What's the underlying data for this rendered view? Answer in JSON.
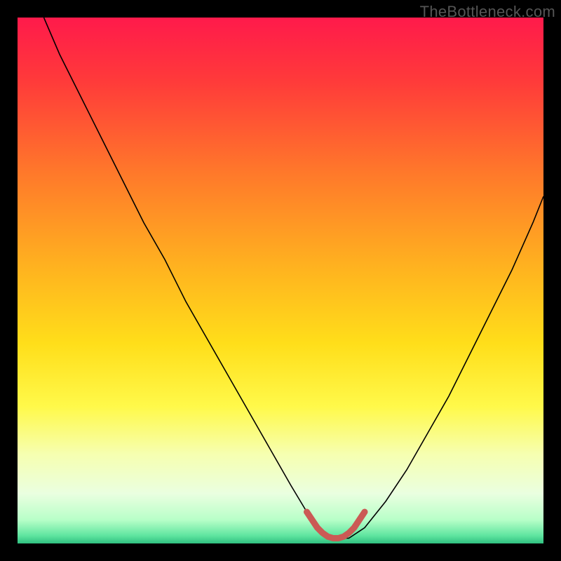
{
  "watermark": "TheBottleneck.com",
  "colors": {
    "frame_bg": "#000000",
    "curve_stroke": "#000000",
    "sweet_stroke": "#cb5a55"
  },
  "chart_data": {
    "type": "line",
    "title": "",
    "xlabel": "",
    "ylabel": "",
    "xlim": [
      0,
      100
    ],
    "ylim": [
      0,
      100
    ],
    "gradient_stops": [
      {
        "offset": 0.0,
        "color": "#ff1a4b"
      },
      {
        "offset": 0.12,
        "color": "#ff3a3a"
      },
      {
        "offset": 0.3,
        "color": "#ff7a2a"
      },
      {
        "offset": 0.48,
        "color": "#ffb41f"
      },
      {
        "offset": 0.62,
        "color": "#ffde1a"
      },
      {
        "offset": 0.74,
        "color": "#fff94a"
      },
      {
        "offset": 0.83,
        "color": "#f6ffb0"
      },
      {
        "offset": 0.905,
        "color": "#eaffe0"
      },
      {
        "offset": 0.955,
        "color": "#b8ffc8"
      },
      {
        "offset": 0.985,
        "color": "#5fe5a0"
      },
      {
        "offset": 1.0,
        "color": "#30c080"
      }
    ],
    "series": [
      {
        "name": "bottleneck-curve",
        "x": [
          5,
          8,
          12,
          16,
          20,
          24,
          28,
          32,
          36,
          40,
          44,
          48,
          52,
          55,
          57,
          60,
          63,
          66,
          70,
          74,
          78,
          82,
          86,
          90,
          94,
          98,
          100
        ],
        "values": [
          100,
          93,
          85,
          77,
          69,
          61,
          54,
          46,
          39,
          32,
          25,
          18,
          11,
          6,
          3,
          1,
          1,
          3,
          8,
          14,
          21,
          28,
          36,
          44,
          52,
          61,
          66
        ]
      },
      {
        "name": "sweet-spot",
        "x": [
          55,
          56,
          57,
          58,
          59,
          60,
          61,
          62,
          63,
          64,
          65,
          66
        ],
        "values": [
          6,
          4.5,
          3,
          2,
          1.3,
          1,
          1,
          1.3,
          2,
          3,
          4.5,
          6
        ]
      }
    ]
  }
}
